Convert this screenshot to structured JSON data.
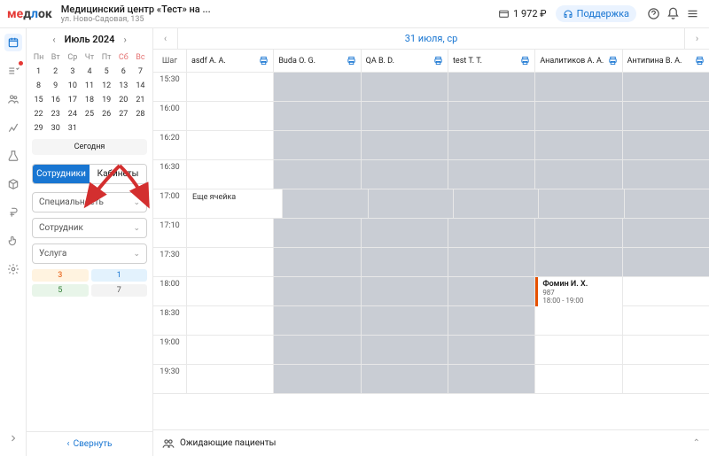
{
  "topbar": {
    "logo_parts": {
      "p1": "м",
      "p2": "е",
      "p3": "д",
      "p4": "л",
      "p5": "о",
      "p6": "к"
    },
    "clinic_name": "Медицинский центр «Тест» на ...",
    "clinic_addr": "ул. Ново-Садовая, 135",
    "balance": "1 972 ₽",
    "support": "Поддержка"
  },
  "calendar": {
    "title": "Июль 2024",
    "dow": [
      "Пн",
      "Вт",
      "Ср",
      "Чт",
      "Пт",
      "Сб",
      "Вс"
    ],
    "weeks": [
      [
        1,
        2,
        3,
        4,
        5,
        6,
        7
      ],
      [
        8,
        9,
        10,
        11,
        12,
        13,
        14
      ],
      [
        15,
        16,
        17,
        18,
        19,
        20,
        21
      ],
      [
        22,
        23,
        24,
        25,
        26,
        27,
        28
      ],
      [
        29,
        30,
        31,
        "",
        "",
        "",
        ""
      ]
    ],
    "selected": 31,
    "today": "Сегодня"
  },
  "tabs": {
    "staff": "Сотрудники",
    "rooms": "Кабинеты"
  },
  "filters": {
    "specialty": "Специальность",
    "staff": "Сотрудник",
    "service": "Услуга"
  },
  "chips": {
    "3": "3",
    "1": "1",
    "5": "5",
    "7": "7"
  },
  "collapse": "Свернуть",
  "schedule": {
    "date_title": "31 июля, ср",
    "step": "Шаг",
    "resources": [
      "asdf A. A.",
      "Buda O. G.",
      "QA B. D.",
      "test T. T.",
      "Аналитиков А. А.",
      "Антипина В. А."
    ],
    "times": [
      "15:30",
      "16:00",
      "16:20",
      "16:30",
      "17:00",
      "17:10",
      "17:30",
      "18:00",
      "18:30",
      "19:00",
      "19:30"
    ],
    "extra_cell": "Еще ячейка",
    "appointment": {
      "name": "Фомин И. Х.",
      "num": "987",
      "time": "18:00 - 19:00"
    }
  },
  "waiting": "Ожидающие пациенты"
}
